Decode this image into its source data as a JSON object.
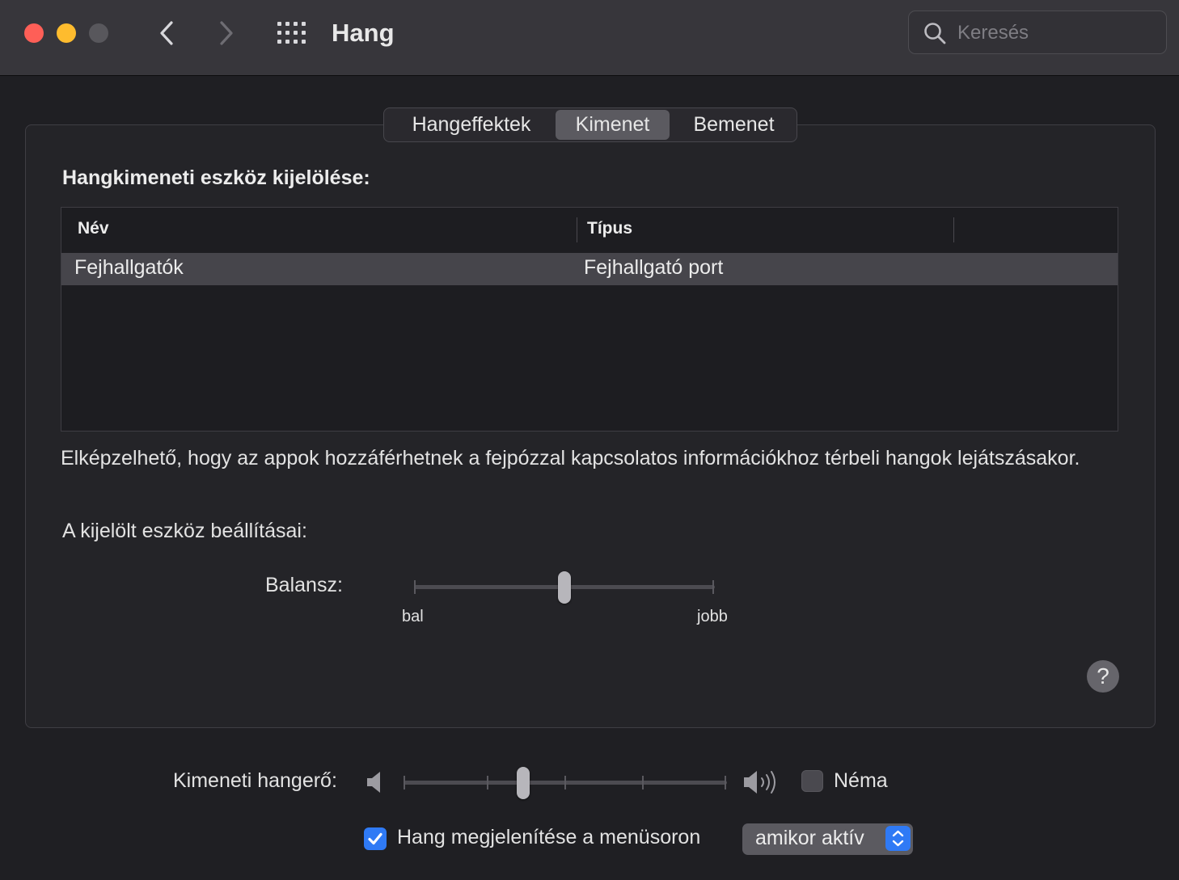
{
  "window": {
    "title": "Hang",
    "search_placeholder": "Keresés"
  },
  "tabs": [
    {
      "label": "Hangeffektek",
      "selected": false
    },
    {
      "label": "Kimenet",
      "selected": true
    },
    {
      "label": "Bemenet",
      "selected": false
    }
  ],
  "output": {
    "section_title": "Hangkimeneti eszköz kijelölése:",
    "columns": {
      "name": "Név",
      "type": "Típus"
    },
    "devices": [
      {
        "name": "Fejhallgatók",
        "type": "Fejhallgató port",
        "selected": true
      }
    ],
    "info_text": "Elképzelhető, hogy az appok hozzáférhetnek a fejpózzal kapcsolatos információkhoz térbeli hangok lejátszásakor.",
    "settings_title": "A kijelölt eszköz beállításai:",
    "balance": {
      "label": "Balansz:",
      "left_label": "bal",
      "right_label": "jobb",
      "value": 0.5
    }
  },
  "help_label": "?",
  "volume": {
    "label": "Kimeneti hangerő:",
    "value": 0.37,
    "mute_label": "Néma",
    "muted": false
  },
  "menubar": {
    "checkbox_label": "Hang megjelenítése a menüsoron",
    "checked": true,
    "select_value": "amikor aktív"
  },
  "colors": {
    "accent": "#2f7af5",
    "close": "#fe5f57",
    "minimize": "#febc2e"
  }
}
